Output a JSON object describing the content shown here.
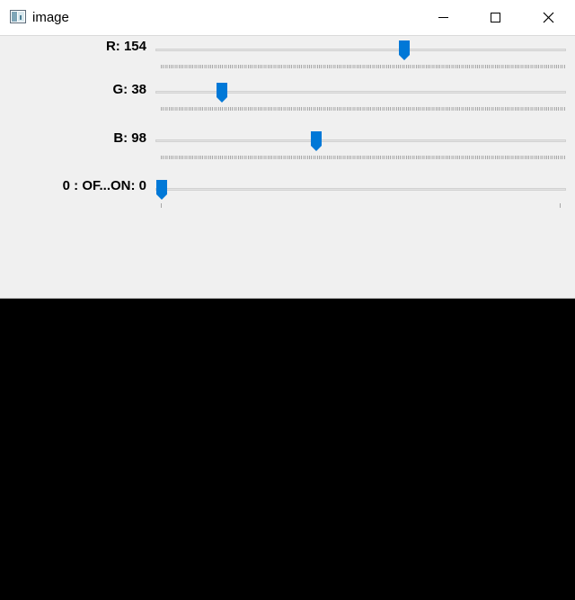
{
  "window": {
    "title": "image",
    "icon": "window-app-icon",
    "controls": [
      "minimize-icon",
      "maximize-icon",
      "close-icon"
    ]
  },
  "trackbars": [
    {
      "label": "R: 154",
      "value": 154,
      "min": 0,
      "max": 255,
      "ticks": "dense"
    },
    {
      "label": "G: 38",
      "value": 38,
      "min": 0,
      "max": 255,
      "ticks": "dense"
    },
    {
      "label": "B: 98",
      "value": 98,
      "min": 0,
      "max": 255,
      "ticks": "dense"
    },
    {
      "label": "0 : OF...ON: 0",
      "value": 0,
      "min": 0,
      "max": 1,
      "ticks": "endpoints"
    }
  ],
  "image": {
    "fill_color": "#000000"
  },
  "colors": {
    "thumb": "#0078d7",
    "panel_bg": "#f0f0f0",
    "titlebar_bg": "#ffffff"
  }
}
